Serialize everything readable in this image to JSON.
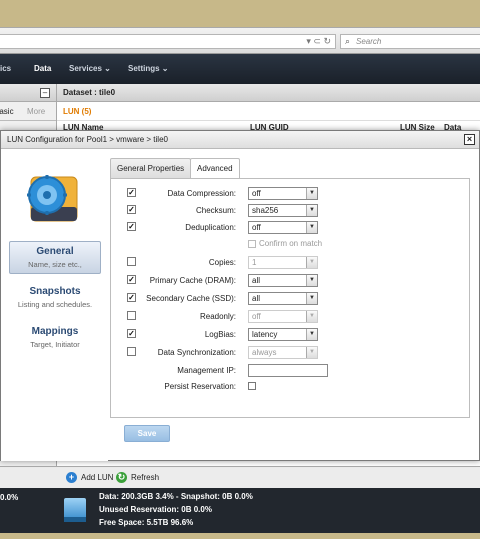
{
  "browser": {
    "search_placeholder": "Search"
  },
  "nav": {
    "items": [
      "ics",
      "Data",
      "Services",
      "Settings"
    ],
    "active": "Data"
  },
  "left_panel": {
    "tab_basic": "Basic",
    "tab_more": "More"
  },
  "right_panel": {
    "breadcrumb": "Dataset : tile0",
    "lun_count_label": "LUN (5)",
    "columns": [
      "LUN Name",
      "LUN GUID",
      "LUN Size",
      "Data"
    ]
  },
  "dialog": {
    "title": "LUN Configuration for Pool1 > vmware > tile0",
    "tabs": [
      "General Properties",
      "Advanced"
    ],
    "active_tab": "Advanced",
    "sidebar": [
      {
        "title": "General",
        "subtitle": "Name, size etc.,"
      },
      {
        "title": "Snapshots",
        "subtitle": "Listing and schedules."
      },
      {
        "title": "Mappings",
        "subtitle": "Target, Initiator"
      }
    ],
    "fields": {
      "compression": {
        "label": "Data Compression:",
        "value": "off",
        "checked": true
      },
      "checksum": {
        "label": "Checksum:",
        "value": "sha256",
        "checked": true
      },
      "dedup": {
        "label": "Deduplication:",
        "value": "off",
        "checked": true
      },
      "confirm": {
        "label": "Confirm on match"
      },
      "copies": {
        "label": "Copies:",
        "value": "1",
        "checked": false
      },
      "primary_cache": {
        "label": "Primary Cache (DRAM):",
        "value": "all",
        "checked": true
      },
      "secondary_cache": {
        "label": "Secondary Cache (SSD):",
        "value": "all",
        "checked": true
      },
      "readonly": {
        "label": "Readonly:",
        "value": "off",
        "checked": false
      },
      "logbias": {
        "label": "LogBias:",
        "value": "latency",
        "checked": true
      },
      "sync": {
        "label": "Data Synchronization:",
        "value": "always",
        "checked": false
      },
      "mgmt_ip": {
        "label": "Management IP:",
        "value": ""
      },
      "persist": {
        "label": "Persist Reservation:"
      }
    },
    "save_label": "Save"
  },
  "toolbar": {
    "add_lun": "Add LUN",
    "refresh": "Refresh"
  },
  "info": {
    "left_pct": "0.0%",
    "data_line": "Data: 200.3GB 3.4% - Snapshot: 0B 0.0%",
    "unused_line": "Unused Reservation: 0B 0.0%",
    "free_line": "Free Space: 5.5TB 96.6%"
  }
}
